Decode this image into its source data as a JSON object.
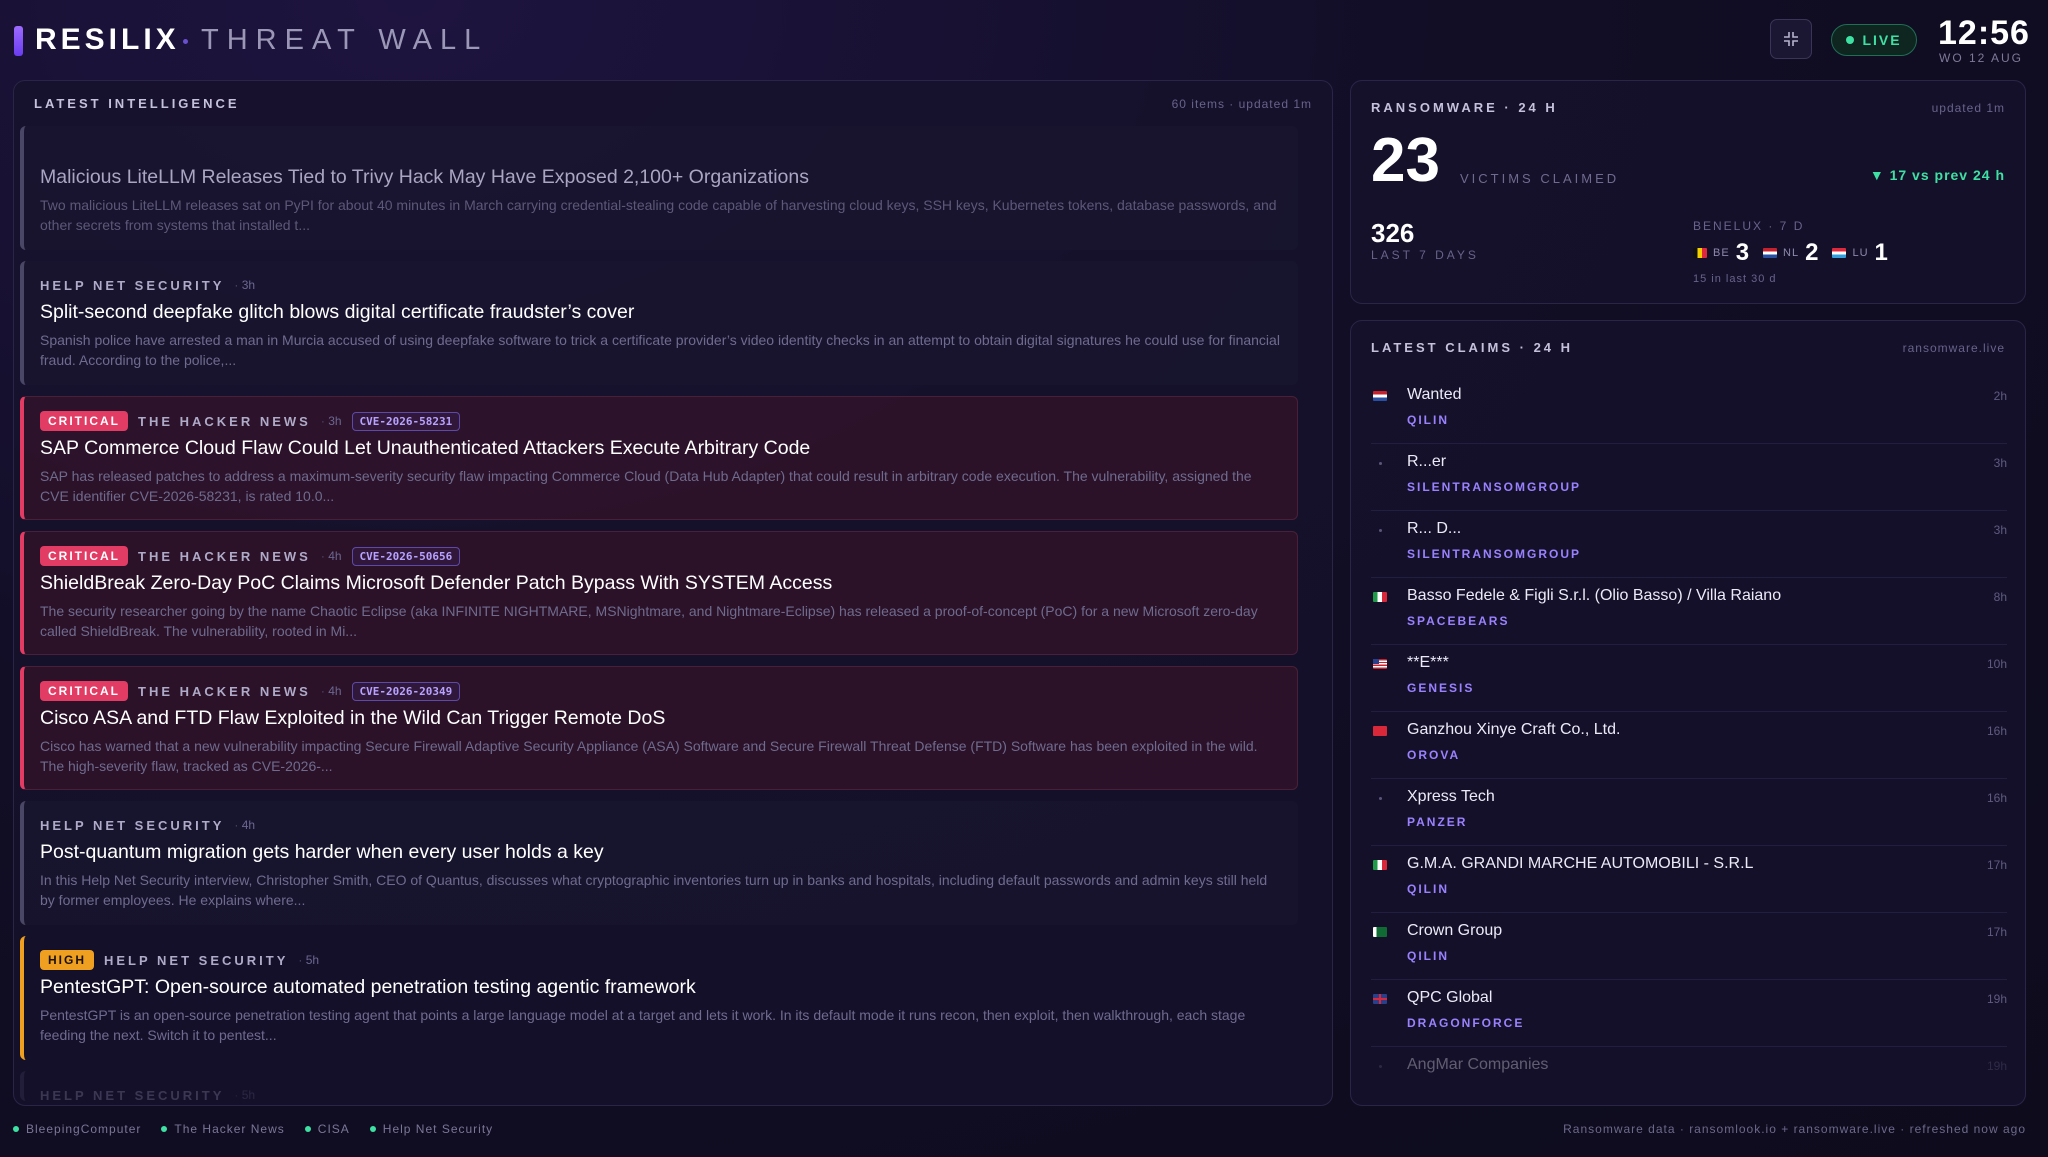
{
  "header": {
    "brand": "RESILIX",
    "subtitle": "THREAT WALL",
    "live_label": "LIVE",
    "clock": "12:56",
    "date": "WO 12 AUG"
  },
  "intel": {
    "title": "LATEST INTELLIGENCE",
    "meta": "60 items · updated 1m",
    "items": [
      {
        "severity": "",
        "source": "",
        "age": "",
        "cve": "",
        "title": "Malicious LiteLLM Releases Tied to Trivy Hack May Have Exposed 2,100+ Organizations",
        "desc": "Two malicious LiteLLM releases sat on PyPI for about 40 minutes in March carrying credential-stealing code capable of harvesting cloud keys, SSH keys, Kubernetes tokens, database passwords, and other secrets from systems that installed t..."
      },
      {
        "severity": "",
        "source": "HELP NET SECURITY",
        "age": "3h",
        "cve": "",
        "title": "Split-second deepfake glitch blows digital certificate fraudster’s cover",
        "desc": "Spanish police have arrested a man in Murcia accused of using deepfake software to trick a certificate provider’s video identity checks in an attempt to obtain digital signatures he could use for financial fraud. According to the police,..."
      },
      {
        "severity": "CRITICAL",
        "source": "THE HACKER NEWS",
        "age": "3h",
        "cve": "CVE-2026-58231",
        "title": "SAP Commerce Cloud Flaw Could Let Unauthenticated Attackers Execute Arbitrary Code",
        "desc": "SAP has released patches to address a maximum-severity security flaw impacting Commerce Cloud (Data Hub Adapter) that could result in arbitrary code execution. The vulnerability, assigned the CVE identifier CVE-2026-58231, is rated 10.0..."
      },
      {
        "severity": "CRITICAL",
        "source": "THE HACKER NEWS",
        "age": "4h",
        "cve": "CVE-2026-50656",
        "title": "ShieldBreak Zero-Day PoC Claims Microsoft Defender Patch Bypass With SYSTEM Access",
        "desc": "The security researcher going by the name Chaotic Eclipse (aka INFINITE NIGHTMARE, MSNightmare, and Nightmare-Eclipse) has released a proof-of-concept (PoC) for a new Microsoft zero-day called ShieldBreak. The vulnerability, rooted in Mi..."
      },
      {
        "severity": "CRITICAL",
        "source": "THE HACKER NEWS",
        "age": "4h",
        "cve": "CVE-2026-20349",
        "title": "Cisco ASA and FTD Flaw Exploited in the Wild Can Trigger Remote DoS",
        "desc": "Cisco has warned that a new vulnerability impacting Secure Firewall Adaptive Security Appliance (ASA) Software and Secure Firewall Threat Defense (FTD) Software has been exploited in the wild. The high-severity flaw, tracked as CVE-2026-..."
      },
      {
        "severity": "",
        "source": "HELP NET SECURITY",
        "age": "4h",
        "cve": "",
        "title": "Post-quantum migration gets harder when every user holds a key",
        "desc": "In this Help Net Security interview, Christopher Smith, CEO of Quantus, discusses what cryptographic inventories turn up in banks and hospitals, including default passwords and admin keys still held by former employees. He explains where..."
      },
      {
        "severity": "HIGH",
        "source": "HELP NET SECURITY",
        "age": "5h",
        "cve": "",
        "title": "PentestGPT: Open-source automated penetration testing agentic framework",
        "desc": "PentestGPT is an open-source penetration testing agent that points a large language model at a target and lets it work. In its default mode it runs recon, then exploit, then walkthrough, each stage feeding the next. Switch it to pentest..."
      }
    ],
    "cut_source": "HELP NET SECURITY",
    "cut_age": "5h"
  },
  "ransomware": {
    "title": "RANSOMWARE · 24 H",
    "meta": "updated 1m",
    "victims": "23",
    "victims_label": "VICTIMS CLAIMED",
    "delta": "▼ 17 vs prev 24 h",
    "week_count": "326",
    "week_label": "LAST 7 DAYS",
    "benelux_title": "BENELUX · 7 D",
    "benelux": [
      {
        "code": "BE",
        "count": "3"
      },
      {
        "code": "NL",
        "count": "2"
      },
      {
        "code": "LU",
        "count": "1"
      }
    ],
    "benelux_note": "15 in last 30 d"
  },
  "claims": {
    "title": "LATEST CLAIMS · 24 H",
    "meta": "ransomware.live",
    "items": [
      {
        "flag": "nl",
        "name": "Wanted",
        "group": "QILIN",
        "age": "2h"
      },
      {
        "flag": "",
        "name": "R...er",
        "group": "SILENTRANSOMGROUP",
        "age": "3h"
      },
      {
        "flag": "",
        "name": "R... D...",
        "group": "SILENTRANSOMGROUP",
        "age": "3h"
      },
      {
        "flag": "it",
        "name": "Basso Fedele & Figli S.r.l. (Olio Basso) / Villa Raiano",
        "group": "SPACEBEARS",
        "age": "8h"
      },
      {
        "flag": "us",
        "name": "**E***",
        "group": "GENESIS",
        "age": "10h"
      },
      {
        "flag": "hk",
        "name": "Ganzhou Xinye Craft Co., Ltd.",
        "group": "OROVA",
        "age": "16h"
      },
      {
        "flag": "",
        "name": "Xpress Tech",
        "group": "PANZER",
        "age": "16h"
      },
      {
        "flag": "it",
        "name": "G.M.A. GRANDI MARCHE AUTOMOBILI - S.R.L",
        "group": "QILIN",
        "age": "17h"
      },
      {
        "flag": "pk",
        "name": "Crown Group",
        "group": "QILIN",
        "age": "17h"
      },
      {
        "flag": "gb",
        "name": "QPC Global",
        "group": "DRAGONFORCE",
        "age": "19h"
      },
      {
        "flag": "",
        "name": "AngMar Companies",
        "group": "",
        "age": "19h"
      }
    ]
  },
  "footer": {
    "feeds": [
      "BleepingComputer",
      "The Hacker News",
      "CISA",
      "Help Net Security"
    ],
    "credits": "Ransomware data · ransomlook.io + ransomware.live · refreshed now ago"
  },
  "colors": {
    "critical": "#e23b64",
    "high": "#f0a020",
    "live": "#3fe0a3",
    "group": "#9a82ff"
  }
}
